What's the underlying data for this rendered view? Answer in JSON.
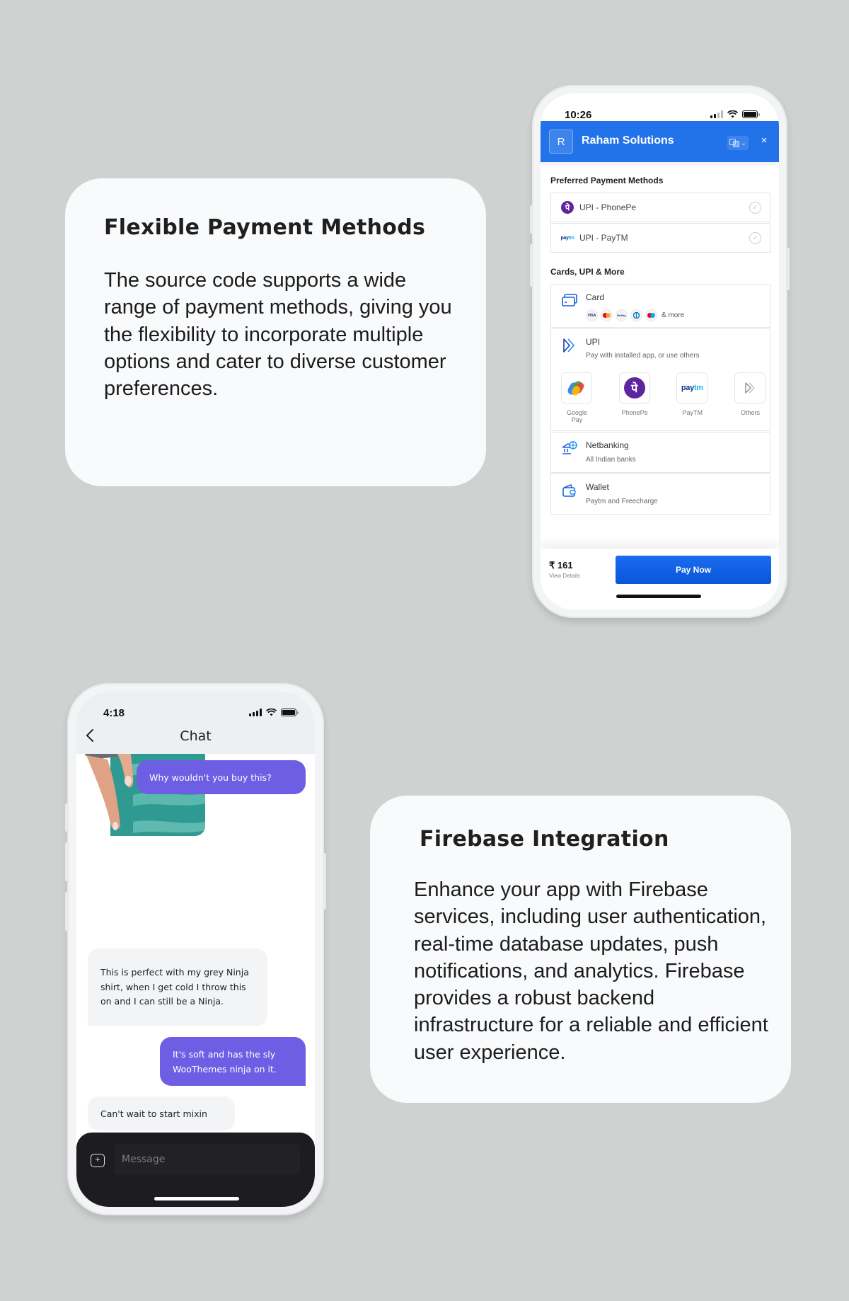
{
  "features": {
    "payment": {
      "title": "Flexible Payment Methods",
      "body": "The source code supports a wide range of payment methods, giving you the flexibility to incorporate multiple options and cater to diverse customer preferences."
    },
    "firebase": {
      "title": "Firebase Integration",
      "body": "Enhance your app with Firebase services, including user authentication, real-time database updates, push notifications, and analytics. Firebase provides a robust backend infrastructure for a reliable and efficient user experience."
    }
  },
  "payment_app": {
    "status_time": "10:26",
    "brand_color": "#2272ea",
    "merchant_initial": "R",
    "merchant_name": "Raham Solutions",
    "close_label": "×",
    "preferred_label": "Preferred Payment Methods",
    "preferred": [
      {
        "label": "UPI - PhonePe",
        "icon": "phonepe-logo"
      },
      {
        "label": "UPI - PayTM",
        "icon": "paytm-logo"
      }
    ],
    "more_label": "Cards, UPI & More",
    "methods": {
      "card": {
        "title": "Card",
        "more": "& more",
        "logos": [
          "VISA",
          "Mastercard",
          "RuPay",
          "Diners",
          "Maestro"
        ]
      },
      "upi": {
        "title": "UPI",
        "subtitle": "Pay with installed app, or use others",
        "apps": [
          {
            "label": "Google Pay"
          },
          {
            "label": "PhonePe"
          },
          {
            "label": "PayTM"
          },
          {
            "label": "Others"
          }
        ]
      },
      "netbanking": {
        "title": "Netbanking",
        "subtitle": "All Indian banks"
      },
      "wallet": {
        "title": "Wallet",
        "subtitle": "Paytm and Freecharge"
      }
    },
    "amount": "₹ 161",
    "view_details": "View Details",
    "pay_button": "Pay Now"
  },
  "chat_app": {
    "status_time": "4:18",
    "title": "Chat",
    "accent_color": "#6e5ee3",
    "messages": [
      {
        "direction": "out",
        "text": "Why wouldn't you buy this?"
      },
      {
        "direction": "out",
        "type": "image",
        "alt": "teal striped sweater with grey sleeve"
      },
      {
        "direction": "in",
        "text": "This is perfect with my grey Ninja shirt, when I get cold I throw this on and I can still be a Ninja."
      },
      {
        "direction": "out",
        "text": "It's soft and has the sly WooThemes ninja on it."
      },
      {
        "direction": "in",
        "text": "Can't wait to start mixin"
      }
    ],
    "input_placeholder": "Message"
  }
}
